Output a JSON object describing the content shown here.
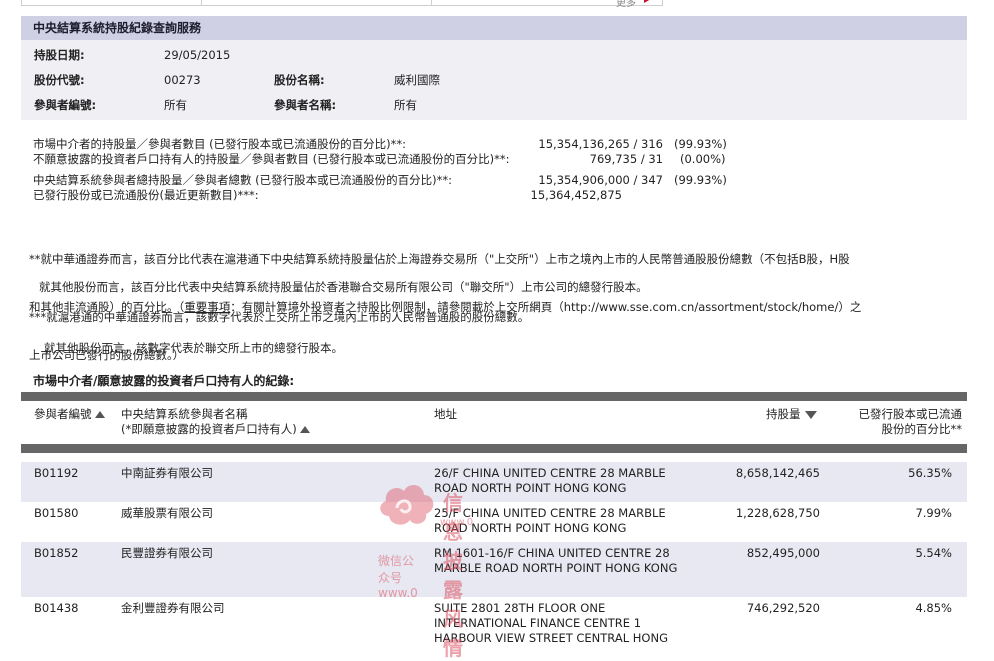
{
  "top": {
    "more_label": "更多"
  },
  "title": "中央結算系統持股紀錄查詢服務",
  "info": {
    "date_label": "持股日期:",
    "date_value": "29/05/2015",
    "code_label": "股份代號:",
    "code_value": "00273",
    "name_label": "股份名稱:",
    "name_value": "威利國際",
    "pid_label": "參與者編號:",
    "pid_value": "所有",
    "pname_label": "參與者名稱:",
    "pname_value": "所有"
  },
  "summary": [
    {
      "text": "市場中介者的持股量／參與者數目 (已發行股本或已流通股份的百分比)**:",
      "number": "15,354,136,265 / 316",
      "pct": "(99.93%)"
    },
    {
      "text": "不願意披露的投資者戶口持有人的持股量／參與者數目 (已發行股本或已流通股份的百分比)**:",
      "number": "769,735 / 31",
      "pct": "(0.00%)"
    },
    {
      "text": "中央結算系統參與者總持股量／參與者總數 (已發行股本或已流通股份的百分比)**:",
      "number": "15,354,906,000 / 347",
      "pct": "(99.93%)"
    },
    {
      "text": "已發行股份或已流通股份(最近更新數目)***:",
      "number": "15,364,452,875",
      "pct": ""
    }
  ],
  "notes": {
    "n1_l1": "**就中華通證券而言，該百分比代表在滬港通下中央結算系統持股量佔於上海證券交易所（\"上交所\"）上市之境內上市的人民幣普通股股份總數（不包括B股，H股",
    "n1_l2_pre": "和其他非流通股）的百分比。（",
    "n1_important": "重要事項",
    "n1_l2_post": "：有關計算境外投資者之持股比例限制，請參閱載於上交所網頁（http://www.sse.com.cn/assortment/stock/home/）之",
    "n1_l3": "上市公司已發行的股份總數。）",
    "n2": "就其他股份而言，該百分比代表中央結算系統持股量佔於香港聯合交易所有限公司（\"聯交所\"）上市公司的總發行股本。",
    "n3": "***就滬港通的中華通證券而言，該數字代表於上交所上市之境內上市的人民幣普通股的股份總數。",
    "n4": "就其他股份而言，該數字代表於聯交所上市的總發行股本。"
  },
  "section_title": "市場中介者/願意披露的投資者戶口持有人的紀錄:",
  "table": {
    "headers": {
      "pid": "參與者編號",
      "name_l1": "中央結算系統參與者名稱",
      "name_l2": "(*即願意披露的投資者戶口持有人)",
      "address": "地址",
      "holding": "持股量",
      "pct_l1": "已發行股本或已流通",
      "pct_l2": "股份的百分比**"
    },
    "rows": [
      {
        "id": "B01192",
        "name": "中南証券有限公司",
        "address": "26/F CHINA UNITED CENTRE 28 MARBLE ROAD NORTH POINT HONG KONG",
        "holding": "8,658,142,465",
        "pct": "56.35%"
      },
      {
        "id": "B01580",
        "name": "威華股票有限公司",
        "address": "25/F CHINA UNITED CENTRE 28 MARBLE ROAD NORTH POINT HONG KONG",
        "holding": "1,228,628,750",
        "pct": "7.99%"
      },
      {
        "id": "B01852",
        "name": "民豐證券有限公司",
        "address": "RM 1601-16/F CHINA UNITED CENTRE 28 MARBLE ROAD NORTH POINT HONG KONG",
        "holding": "852,495,000",
        "pct": "5.54%"
      },
      {
        "id": "B01438",
        "name": "金利豐證券有限公司",
        "address": "SUITE 2801 28TH FLOOR ONE INTERNATIONAL FINANCE CENTRE 1 HARBOUR VIEW STREET CENTRAL HONG",
        "holding": "746,292,520",
        "pct": "4.85%"
      }
    ]
  },
  "watermark": {
    "line1": "信息披露风情",
    "line2": "www.0",
    "line3": "微信公众号    www.0"
  },
  "colors": {
    "title_bg": "#cfd0e3",
    "panel_bg": "#efeff4",
    "alt_row": "#e7e8f1",
    "header_bar": "#666666",
    "watermark": "#dd5464"
  }
}
